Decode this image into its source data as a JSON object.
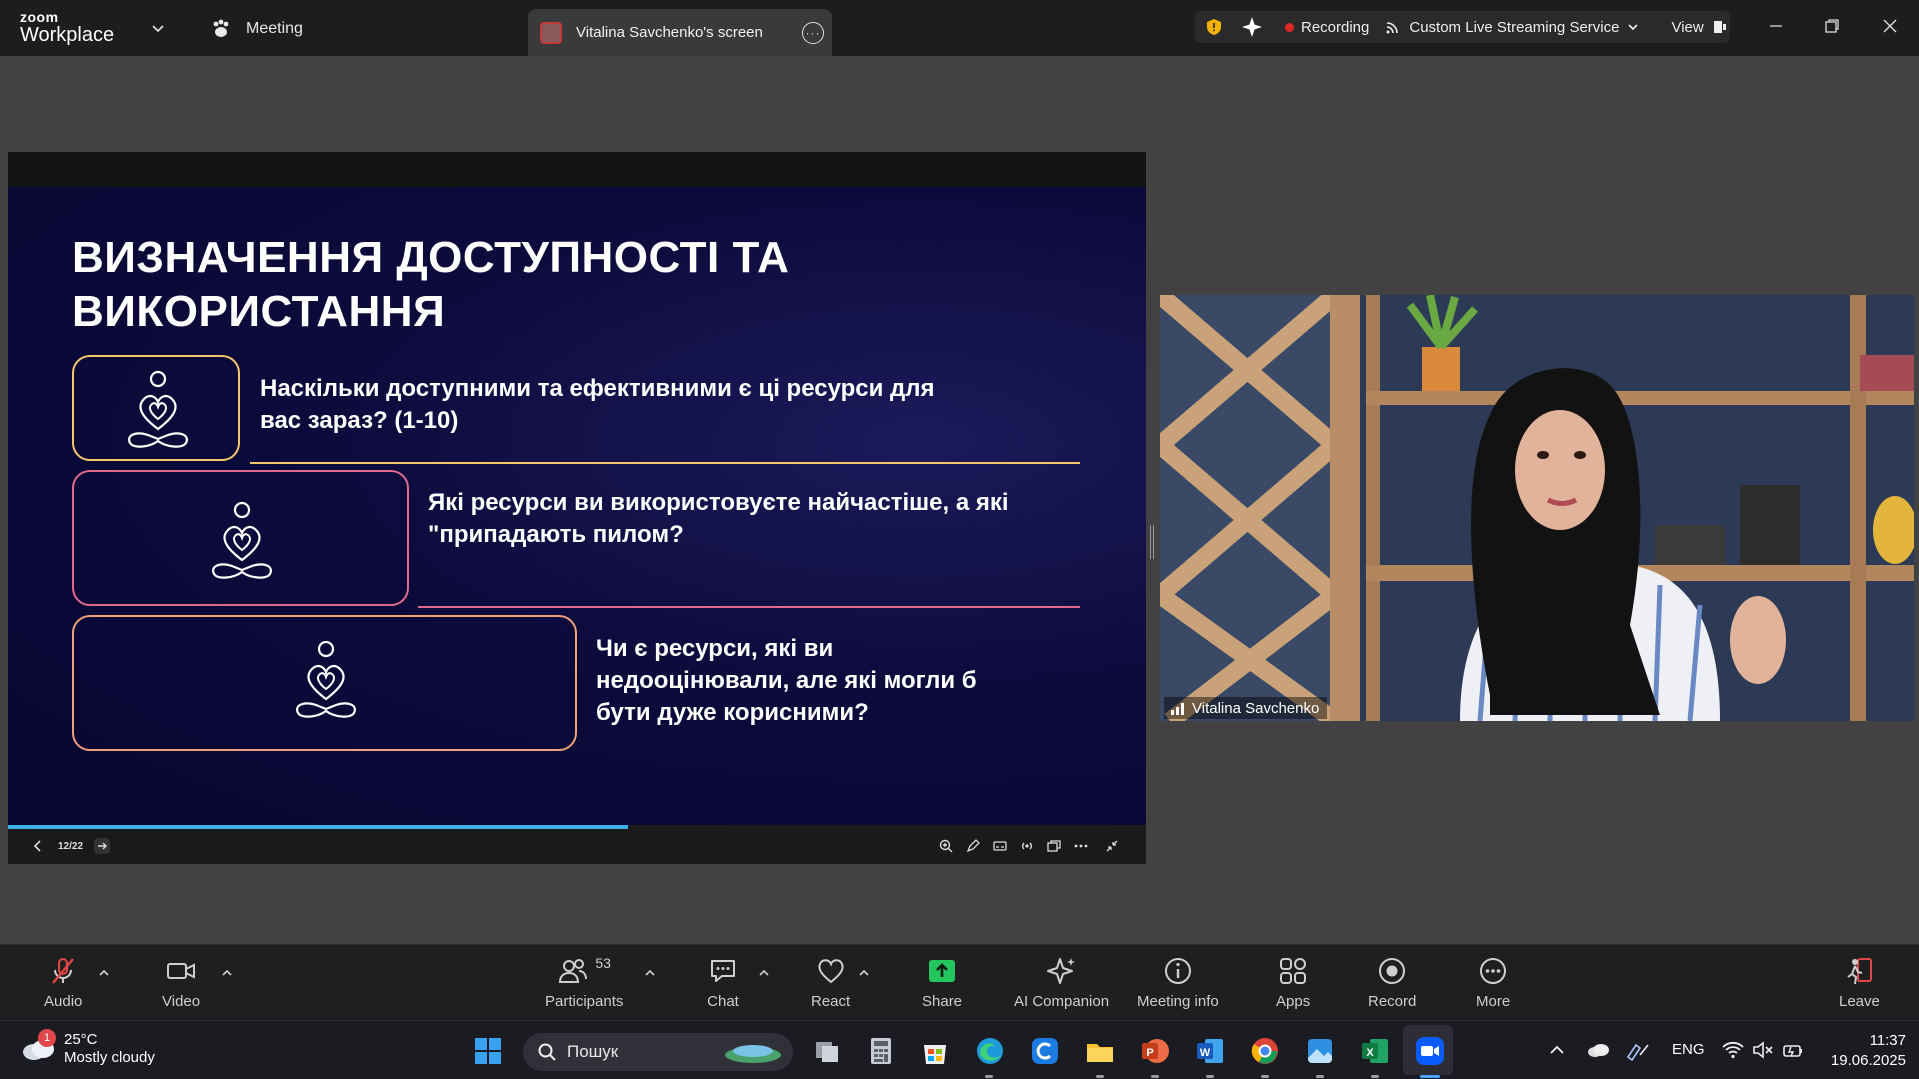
{
  "titlebar": {
    "logo_top": "zoom",
    "logo_bottom": "Workplace",
    "meeting_tab": "Meeting",
    "screen_tab": "Vitalina Savchenko's screen",
    "recording": "Recording",
    "streaming": "Custom Live Streaming Service",
    "view": "View"
  },
  "slide": {
    "title": "ВИЗНАЧЕННЯ ДОСТУПНОСТІ ТА ВИКОРИСТАННЯ",
    "questions": [
      {
        "text": "Наскільки доступними та ефективними є ці ресурси для вас зараз? (1-10)"
      },
      {
        "text": "Які ресурси ви використовуєте найчастіше, а які \"припадають пилом?"
      },
      {
        "text": "Чи є ресурси, які ви недооцінювали, але які могли б бути дуже корисними?"
      }
    ],
    "colors": {
      "card1": "#f3c86a",
      "card2": "#e06a8c",
      "card3": "#f0a07a",
      "background": "#0b0938"
    }
  },
  "share_controls": {
    "page_indicator": "12/22",
    "progress": 0.545
  },
  "video": {
    "participant_name": "Vitalina Savchenko"
  },
  "toolbar": {
    "audio": "Audio",
    "video": "Video",
    "participants": "Participants",
    "participants_count": "53",
    "chat": "Chat",
    "react": "React",
    "share": "Share",
    "ai_companion": "AI Companion",
    "meeting_info": "Meeting info",
    "apps": "Apps",
    "record": "Record",
    "more": "More",
    "leave": "Leave",
    "share_color": "#22c55e"
  },
  "taskbar": {
    "weather_temp": "25°C",
    "weather_desc": "Mostly cloudy",
    "weather_badge": "1",
    "search_placeholder": "Пошук",
    "language": "ENG",
    "time": "11:37",
    "date": "19.06.2025"
  }
}
